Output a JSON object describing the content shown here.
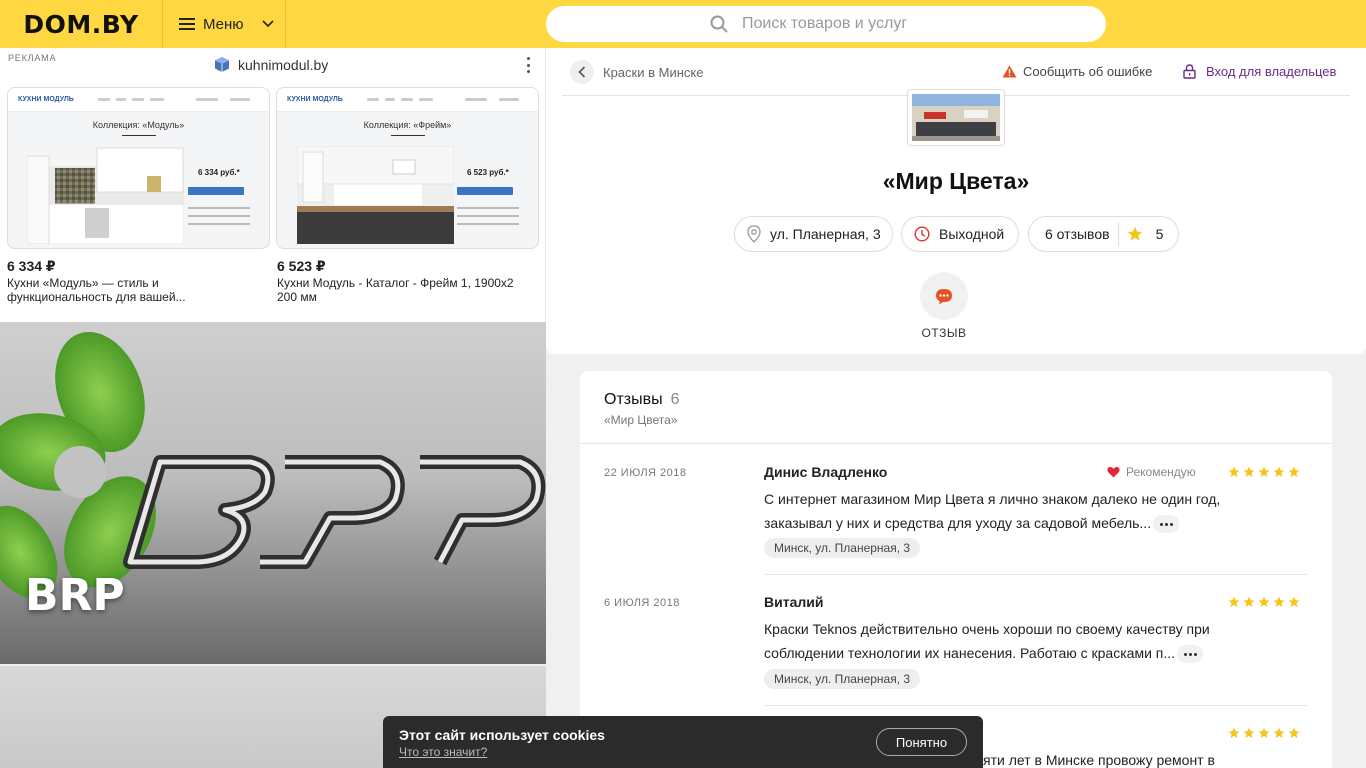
{
  "header": {
    "logo": "DOM.BY",
    "menu_label": "Меню",
    "search_placeholder": "Поиск товаров и услуг",
    "accent_color": "#ffd740"
  },
  "ad": {
    "label": "РЕКЛАМА",
    "domain": "kuhnimodul.by",
    "cards": [
      {
        "brand": "КУХНИ МОДУЛЬ",
        "collection": "Коллекция: «Модуль»",
        "inner_price": "6 334 руб.*",
        "price": "6 334 ₽",
        "description": "Кухни «Модуль» — стиль и функциональность для вашей..."
      },
      {
        "brand": "КУХНИ МОДУЛЬ",
        "collection": "Коллекция: «Фрейм»",
        "inner_price": "6 523 руб.*",
        "price": "6 523 ₽",
        "description": "Кухни Модуль - Каталог - Фрейм 1, 1900x2 200 мм"
      }
    ]
  },
  "promo": {
    "name": "BRP"
  },
  "company": {
    "breadcrumb": "Краски в Минске",
    "report_label": "Сообщить об ошибке",
    "owner_label": "Вход для владельцев",
    "name": "«Мир Цвета»",
    "address": "ул. Планерная, 3",
    "status": "Выходной",
    "reviews_count_label": "6 отзывов",
    "rating": "5",
    "review_action_label": "ОТЗЫВ"
  },
  "reviews": {
    "title": "Отзывы",
    "count": "6",
    "subtitle": "«Мир Цвета»",
    "items": [
      {
        "date": "22 ИЮЛЯ 2018",
        "author": "Динис Владленко",
        "recommend": "Рекомендую",
        "stars": 5,
        "line1": "С интернет магазином Мир Цвета я лично знаком далеко не один год,",
        "line2": "заказывал у них и средства для уходу за садовой мебель...",
        "tag": "Минск, ул. Планерная, 3"
      },
      {
        "date": "6 ИЮЛЯ 2018",
        "author": "Виталий",
        "recommend": "",
        "stars": 5,
        "line1": "Краски Teknos действительно очень хороши по своему качеству при",
        "line2": "соблюдении технологии их нанесения. Работаю с красками п...",
        "tag": "Минск, ул. Планерная, 3"
      },
      {
        "date": "",
        "author": "",
        "recommend": "",
        "stars": 5,
        "line1": "яти лет в Минске провожу ремонт в",
        "line2": "",
        "tag": ""
      }
    ]
  },
  "cookie": {
    "text": "Этот сайт использует cookies",
    "link": "Что это значит?",
    "button": "Понятно"
  }
}
